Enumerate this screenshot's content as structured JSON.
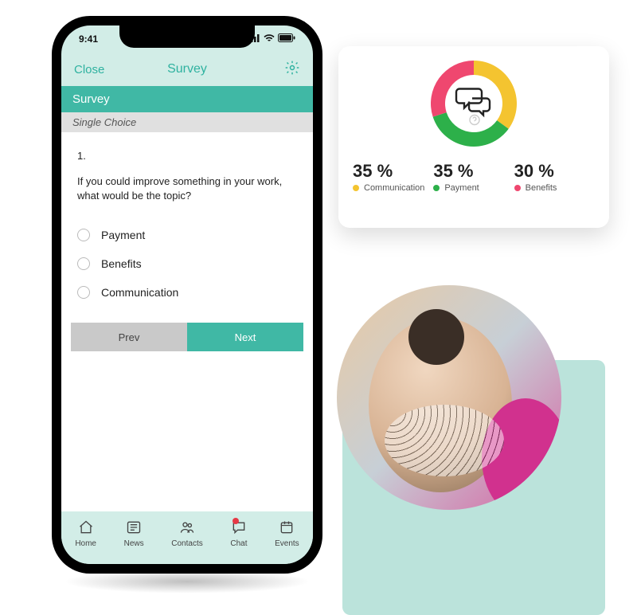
{
  "status": {
    "time": "9:41"
  },
  "nav": {
    "close_label": "Close",
    "title": "Survey"
  },
  "survey": {
    "header": "Survey",
    "subtitle": "Single Choice",
    "q_number": "1.",
    "question_text": "If you could improve something in your work, what would be the topic?",
    "options": [
      {
        "label": "Payment"
      },
      {
        "label": "Benefits"
      },
      {
        "label": "Communication"
      }
    ],
    "prev_label": "Prev",
    "next_label": "Next"
  },
  "tabs": [
    {
      "label": "Home",
      "icon": "home-icon"
    },
    {
      "label": "News",
      "icon": "news-icon"
    },
    {
      "label": "Contacts",
      "icon": "contacts-icon"
    },
    {
      "label": "Chat",
      "icon": "chat-icon",
      "badge": true
    },
    {
      "label": "Events",
      "icon": "events-icon"
    }
  ],
  "chart_data": {
    "type": "pie",
    "title": "",
    "series": [
      {
        "name": "Communication",
        "value": 35,
        "color": "#f4c430"
      },
      {
        "name": "Payment",
        "value": 35,
        "color": "#2db04a"
      },
      {
        "name": "Benefits",
        "value": 30,
        "color": "#ef476f"
      }
    ]
  },
  "chart_legend": {
    "items": [
      {
        "pct": "35 %",
        "label": "Communication",
        "color": "#f4c430"
      },
      {
        "pct": "35 %",
        "label": "Payment",
        "color": "#2db04a"
      },
      {
        "pct": "30 %",
        "label": "Benefits",
        "color": "#ef476f"
      }
    ]
  }
}
